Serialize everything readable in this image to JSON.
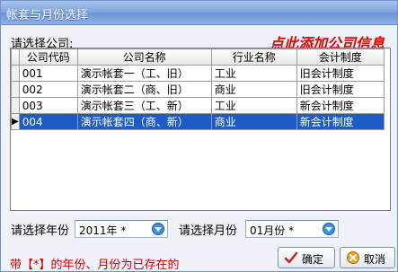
{
  "window": {
    "title": "帐套与月份选择"
  },
  "prompt": "请选择公司:",
  "add_company_link": "点此添加公司信息",
  "table": {
    "columns": [
      "公司代码",
      "公司名称",
      "行业名称",
      "会计制度"
    ],
    "rows": [
      [
        "001",
        "演示帐套一（工、旧）",
        "工业",
        "旧会计制度"
      ],
      [
        "002",
        "演示帐套二（商、旧）",
        "商业",
        "旧会计制度"
      ],
      [
        "003",
        "演示帐套三（工、新）",
        "工业",
        "新会计制度"
      ],
      [
        "004",
        "演示帐套四（商、新）",
        "商业",
        "新会计制度"
      ]
    ],
    "selected_row_indicator": "▶"
  },
  "year": {
    "label": "请选择年份",
    "value": "2011年 *"
  },
  "month": {
    "label": "请选择月份",
    "value": "01月份 *"
  },
  "note": "带【*】的年份、月份为已存在的",
  "buttons": {
    "ok": "确定",
    "cancel": "取消"
  },
  "colors": {
    "selection": "#1d5cc8",
    "link": "#e00000",
    "title_bar": "#7ea2dc"
  }
}
